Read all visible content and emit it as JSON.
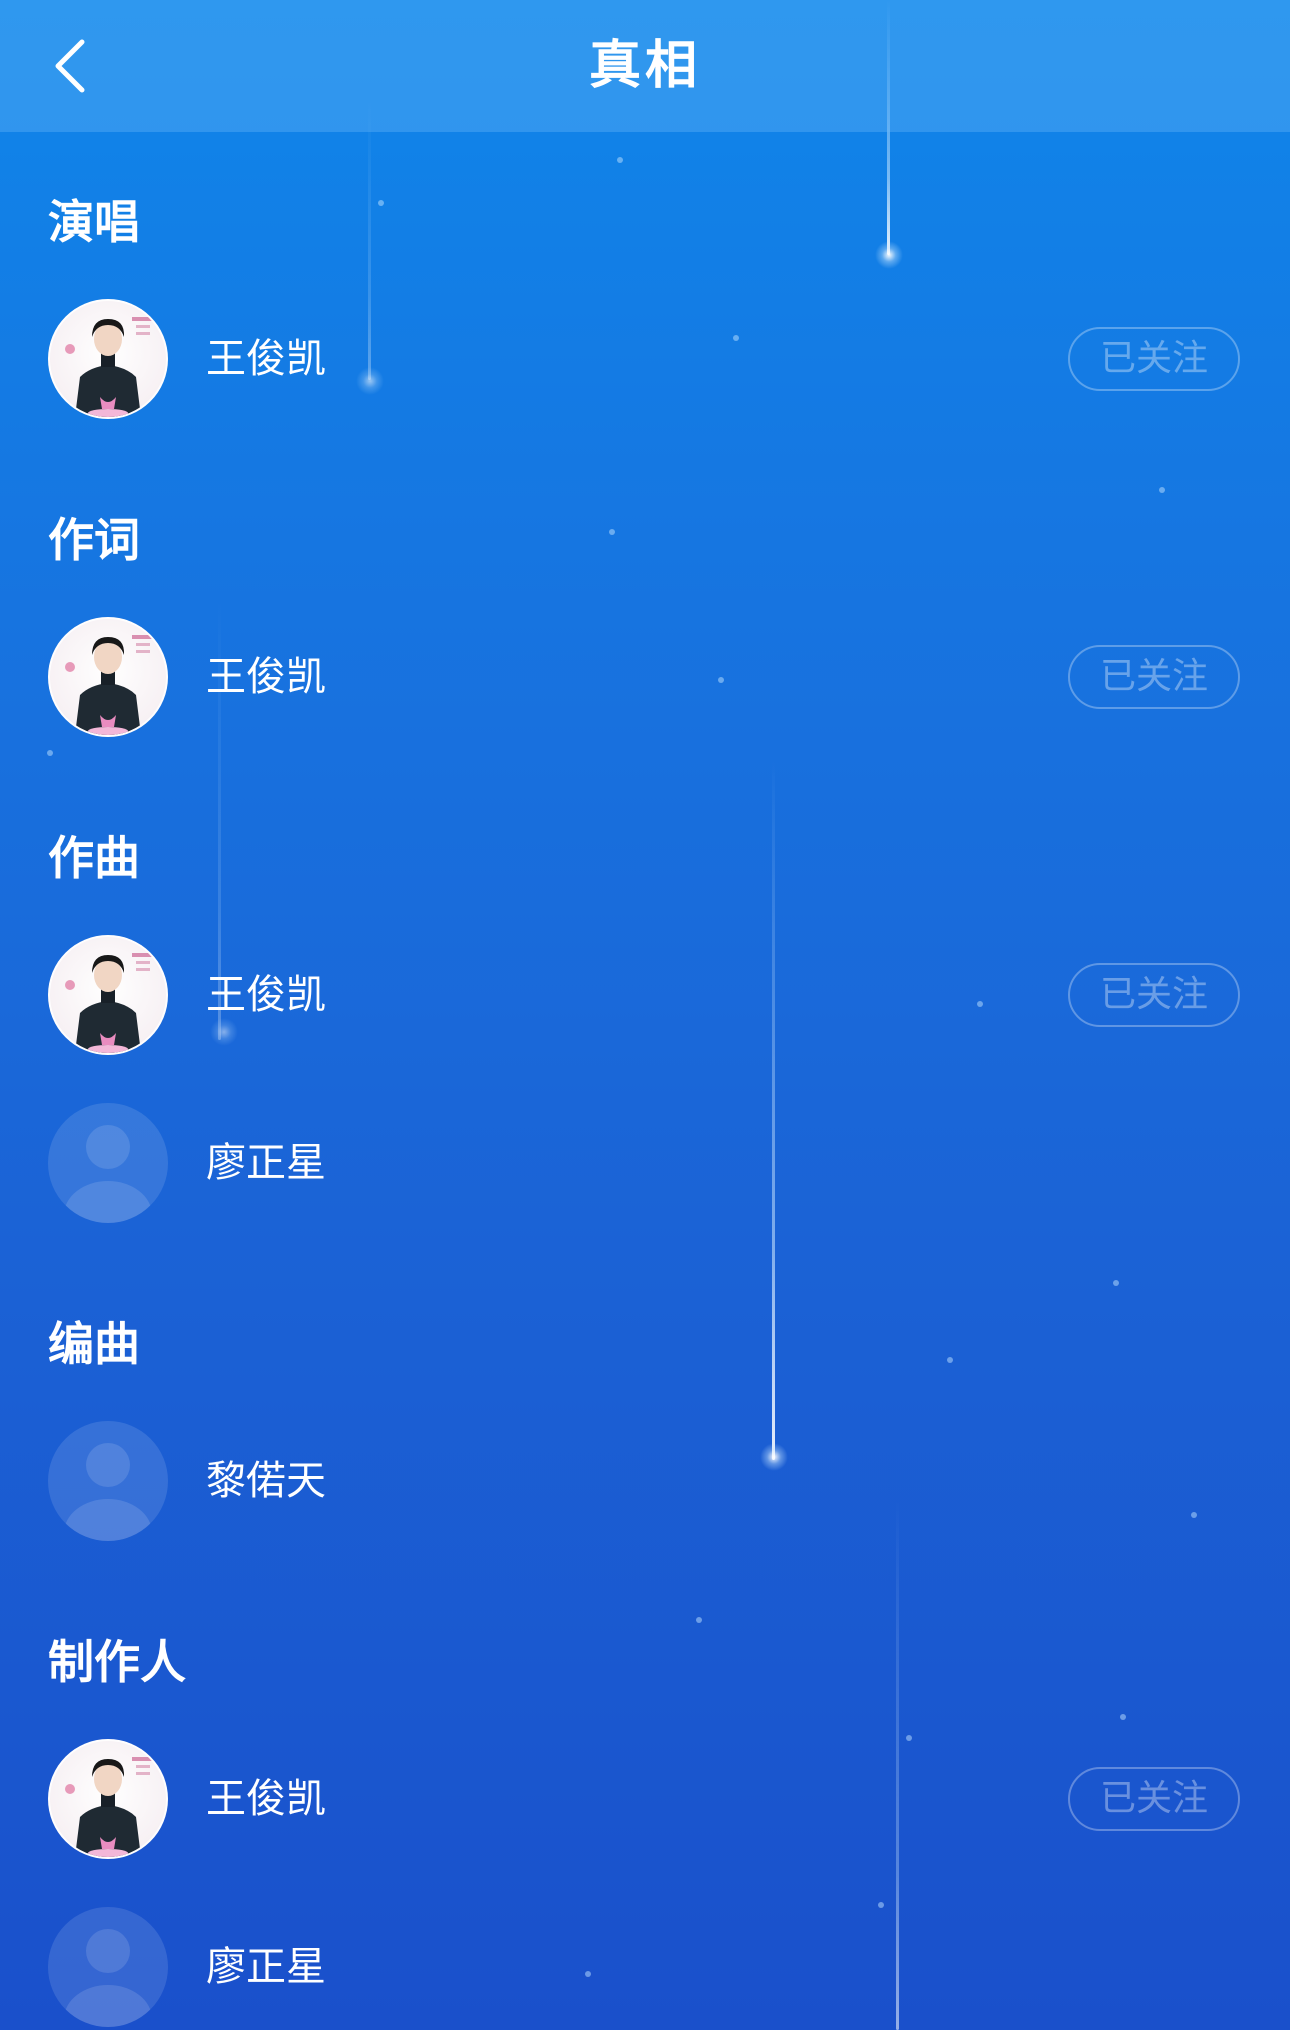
{
  "header": {
    "back_icon": "chevron-left-icon",
    "title": "真相"
  },
  "sections": [
    {
      "title": "演唱",
      "people": [
        {
          "name": "王俊凯",
          "avatar": "photo",
          "follow_label": "已关注"
        }
      ]
    },
    {
      "title": "作词",
      "people": [
        {
          "name": "王俊凯",
          "avatar": "photo",
          "follow_label": "已关注"
        }
      ]
    },
    {
      "title": "作曲",
      "people": [
        {
          "name": "王俊凯",
          "avatar": "photo",
          "follow_label": "已关注"
        },
        {
          "name": "廖正星",
          "avatar": "default-user-icon"
        }
      ]
    },
    {
      "title": "编曲",
      "people": [
        {
          "name": "黎偌天",
          "avatar": "default-user-icon"
        }
      ]
    },
    {
      "title": "制作人",
      "people": [
        {
          "name": "王俊凯",
          "avatar": "photo",
          "follow_label": "已关注"
        },
        {
          "name": "廖正星",
          "avatar": "default-user-icon"
        }
      ]
    }
  ],
  "colors": {
    "background_top": "#0f86ea",
    "background_bottom": "#1a50cb",
    "text": "#ffffff"
  }
}
